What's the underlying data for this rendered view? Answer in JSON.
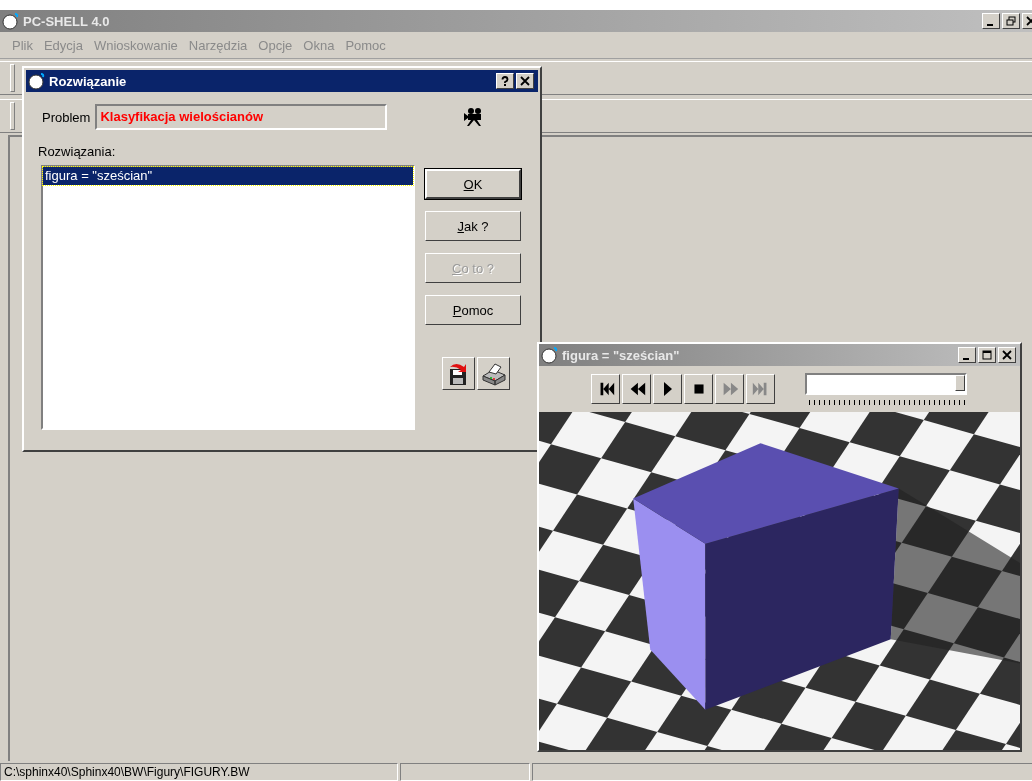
{
  "app": {
    "title": "PC-SHELL 4.0"
  },
  "menu": [
    {
      "label": "Plik"
    },
    {
      "label": "Edycja"
    },
    {
      "label": "Wnioskowanie"
    },
    {
      "label": "Narzędzia"
    },
    {
      "label": "Opcje"
    },
    {
      "label": "Okna"
    },
    {
      "label": "Pomoc"
    }
  ],
  "dialog": {
    "title": "Rozwiązanie",
    "problem_label": "Problem",
    "problem_value": "Klasyfikacja wielościanów",
    "solutions_label": "Rozwiązania:",
    "solutions": [
      {
        "text": "figura = \"sześcian\"",
        "selected": true
      }
    ],
    "buttons": [
      {
        "label": "OK",
        "default": true,
        "disabled": false
      },
      {
        "label": "Jak ?",
        "default": false,
        "disabled": false
      },
      {
        "label": "Co to ?",
        "default": false,
        "disabled": true
      },
      {
        "label": "Pomoc",
        "default": false,
        "disabled": false
      }
    ]
  },
  "viewer": {
    "title": "figura = \"sześcian\"",
    "controls": [
      {
        "kind": "first",
        "disabled": false
      },
      {
        "kind": "rewind",
        "disabled": false
      },
      {
        "kind": "play",
        "disabled": false
      },
      {
        "kind": "stop",
        "disabled": false
      },
      {
        "kind": "forward",
        "disabled": true
      },
      {
        "kind": "last",
        "disabled": true
      }
    ],
    "slider": {
      "level": 1
    }
  },
  "status_bar": [
    {
      "text": "C:\\sphinx40\\Sphinx40\\BW\\Figury\\FIGURY.BW"
    }
  ]
}
